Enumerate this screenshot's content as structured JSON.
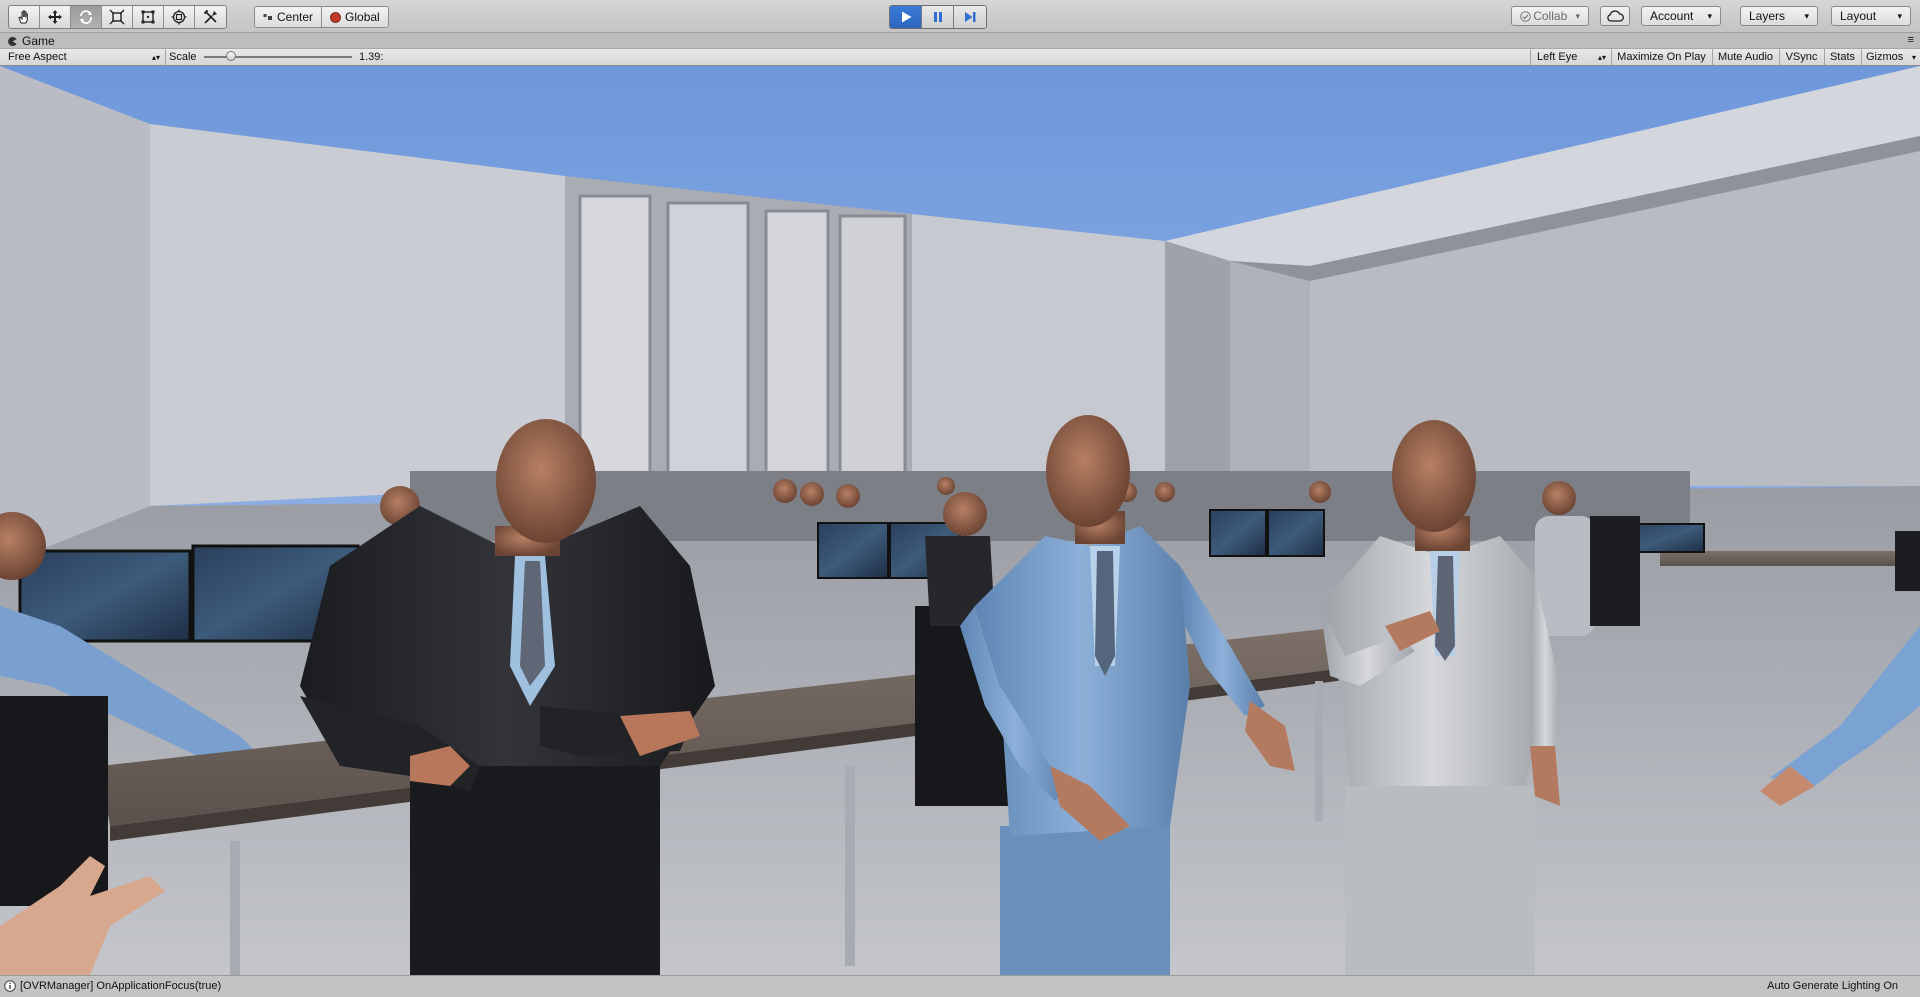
{
  "toolbar": {
    "tools": [
      {
        "icon": "hand-icon",
        "active": false
      },
      {
        "icon": "move-icon",
        "active": false
      },
      {
        "icon": "rotate-icon",
        "active": true
      },
      {
        "icon": "scale-icon",
        "active": false
      },
      {
        "icon": "rect-tool-icon",
        "active": false
      },
      {
        "icon": "transform-icon",
        "active": false
      },
      {
        "icon": "custom-tool-icon",
        "active": false
      }
    ],
    "pivot_label": "Center",
    "space_label": "Global",
    "play_active": true,
    "collab_label": "Collab",
    "account_label": "Account",
    "layers_label": "Layers",
    "layout_label": "Layout"
  },
  "tab": {
    "title": "Game"
  },
  "game_bar": {
    "aspect": "Free Aspect",
    "scale_label": "Scale",
    "scale_value": "1.39:",
    "scale_fraction": 0.18,
    "eye": "Left Eye",
    "maximize_on_play": "Maximize On Play",
    "mute_audio": "Mute Audio",
    "vsync": "VSync",
    "stats": "Stats",
    "gizmos": "Gizmos"
  },
  "status": {
    "message": "[OVRManager] OnApplicationFocus(true)",
    "lighting": "Auto Generate Lighting On"
  },
  "colors": {
    "play_blue": "#2f6fd0",
    "sky": "#8fb3e8"
  }
}
